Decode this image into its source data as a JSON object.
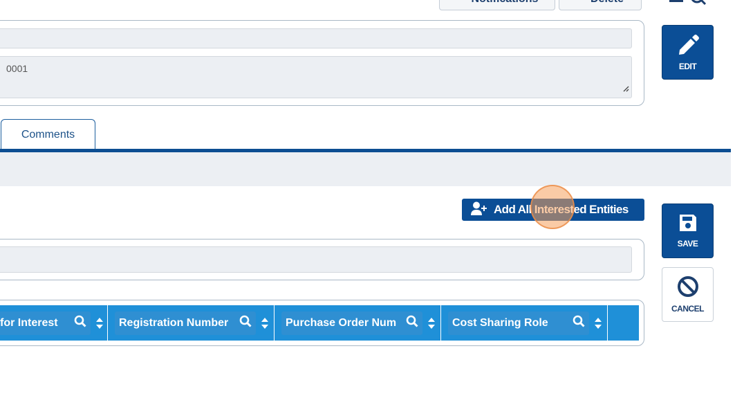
{
  "top_toolbar": {
    "notifications_label": "Notifications",
    "delete_label": "Delete"
  },
  "details": {
    "textarea_value": "0001"
  },
  "side_buttons": {
    "edit_label": "EDIT",
    "save_label": "SAVE",
    "cancel_label": "CANCEL"
  },
  "tabs": [
    {
      "label": "Comments"
    }
  ],
  "actions": {
    "add_all_label": "Add All Interested Entities"
  },
  "table": {
    "columns": [
      {
        "label": "for Interest"
      },
      {
        "label": "Registration Number"
      },
      {
        "label": "Purchase Order Num"
      },
      {
        "label": "Cost Sharing Role"
      }
    ]
  },
  "colors": {
    "primary": "#0b4e96",
    "header": "#1f90d8",
    "tab_rule": "#0d4e92",
    "click_marker": "#f5a15c"
  }
}
